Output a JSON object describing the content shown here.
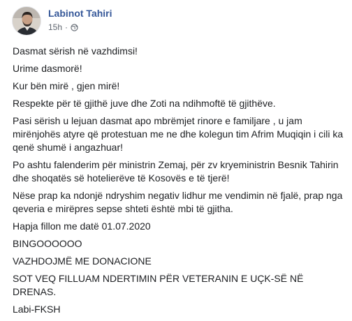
{
  "post": {
    "author": "Labinot Tahiri",
    "time": "15h",
    "separator": "·",
    "privacy_icon": "globe-icon",
    "paragraphs": [
      "Dasmat sërish në vazhdimsi!",
      "Urime dasmorë!",
      "Kur bën mirë , gjen mirë!",
      "Respekte për të gjithë juve dhe Zoti na ndihmoftë të gjithëve.",
      "Pasi sërish u lejuan dasmat apo mbrëmjet rinore e familjare , u jam mirënjohës atyre që protestuan me ne dhe kolegun tim Afrim Muqiqin i cili ka qenë shumë i angazhuar!",
      "Po ashtu falenderim për ministrin Zemaj, për zv kryeministrin Besnik Tahirin dhe shoqatës së hotelierëve të Kosovës e të tjerë!",
      "Nëse prap ka ndonjë ndryshim negativ lidhur me vendimin në fjalë, prap nga qeveria e mirëpres sepse shteti është mbi të gjitha.",
      "Hapja fillon me datë 01.07.2020",
      "BINGOOOOOO",
      "VAZHDOJMË ME DONACIONE",
      "SOT VEQ FILLUAM NDERTIMIN PËR VETERANIN E UÇK-SË NË DRENAS.",
      "Labi-FKSH"
    ]
  }
}
